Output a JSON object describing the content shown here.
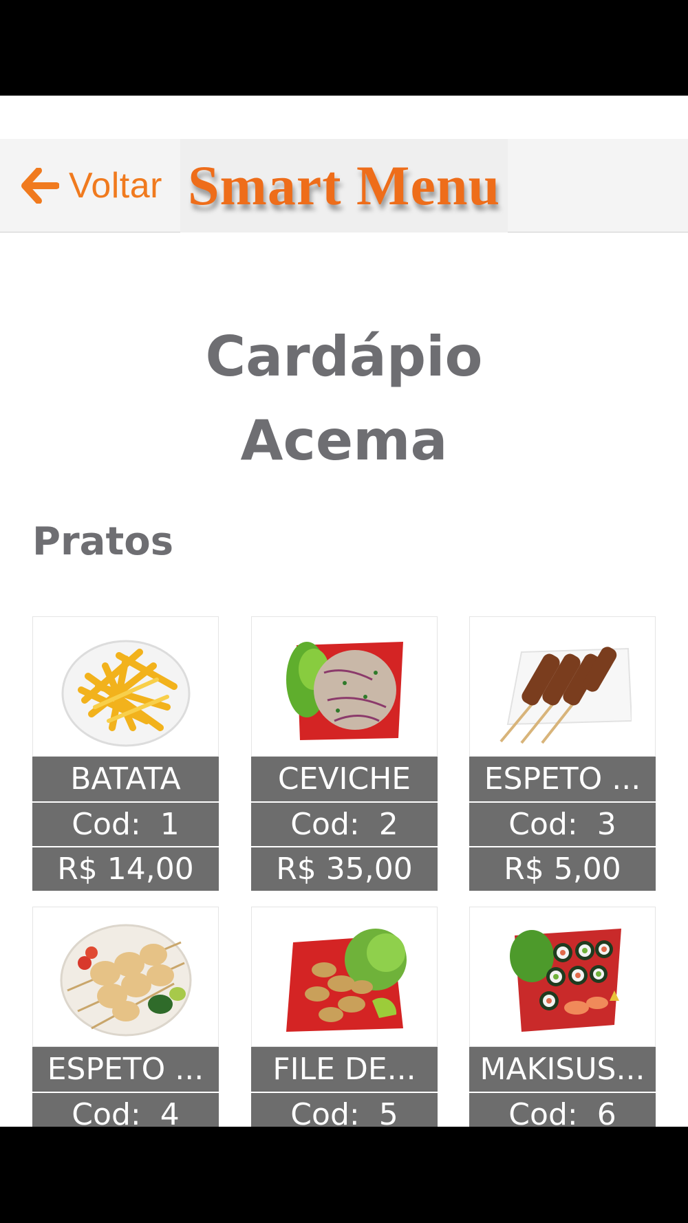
{
  "nav": {
    "back_label": "Voltar",
    "brand": "Smart Menu",
    "accent_color": "#f07a1e"
  },
  "page": {
    "title_line1": "Cardápio",
    "title_line2": "Acema"
  },
  "section": {
    "title": "Pratos"
  },
  "cod_label": "Cod:",
  "items": [
    {
      "name": "BATATA",
      "cod": "1",
      "price": "R$  14,00",
      "photo": "fries"
    },
    {
      "name": "CEVICHE",
      "cod": "2",
      "price": "R$  35,00",
      "photo": "ceviche"
    },
    {
      "name": "ESPETO ...",
      "cod": "3",
      "price": "R$  5,00",
      "photo": "skewers-beef"
    },
    {
      "name": "ESPETO ...",
      "cod": "4",
      "price": "",
      "photo": "skewers-chicken"
    },
    {
      "name": "FILE DE...",
      "cod": "5",
      "price": "",
      "photo": "fried-fish"
    },
    {
      "name": "MAKISUS...",
      "cod": "6",
      "price": "",
      "photo": "sushi"
    }
  ]
}
